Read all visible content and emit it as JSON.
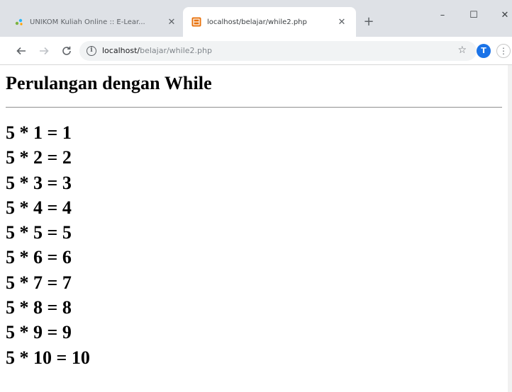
{
  "browser": {
    "tabs": [
      {
        "title": "UNIKOM Kuliah Online :: E-Lear...",
        "active": false
      },
      {
        "title": "localhost/belajar/while2.php",
        "active": true
      }
    ],
    "new_tab_label": "+",
    "window_controls": {
      "minimize": "–",
      "maximize": "☐",
      "close": "✕"
    },
    "address": {
      "host": "localhost/",
      "path": "belajar/while2.php"
    },
    "profile_initial": "T",
    "menu_label": "⋮"
  },
  "page": {
    "title": "Perulangan dengan While",
    "results": [
      "5 * 1 = 1",
      "5 * 2 = 2",
      "5 * 3 = 3",
      "5 * 4 = 4",
      "5 * 5 = 5",
      "5 * 6 = 6",
      "5 * 7 = 7",
      "5 * 8 = 8",
      "5 * 9 = 9",
      "5 * 10 = 10"
    ]
  },
  "colors": {
    "tabstrip": "#dee1e6",
    "omnibox": "#f1f3f4",
    "profile": "#1a73e8",
    "active_favicon": "#e8710a"
  }
}
